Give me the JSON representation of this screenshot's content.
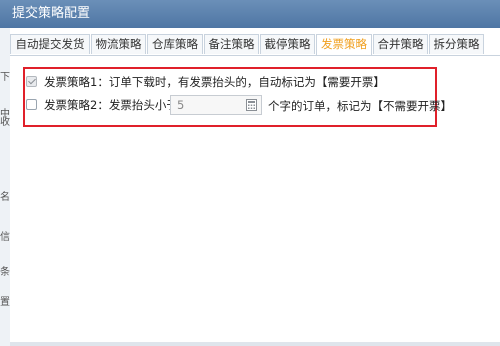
{
  "dialog": {
    "title": "提交策略配置"
  },
  "tabs": [
    {
      "label": "自动提交发货"
    },
    {
      "label": "物流策略"
    },
    {
      "label": "仓库策略"
    },
    {
      "label": "备注策略"
    },
    {
      "label": "截停策略"
    },
    {
      "label": "发票策略",
      "active": true
    },
    {
      "label": "合并策略"
    },
    {
      "label": "拆分策略"
    }
  ],
  "policies": {
    "policy1": {
      "checked": true,
      "text": "发票策略1：订单下载时，有发票抬头的，自动标记为【需要开票】"
    },
    "policy2": {
      "checked": false,
      "prefix": "发票策略2：发票抬头小于",
      "value": "5",
      "suffix": "个字的订单，标记为【不需要开票】"
    }
  },
  "left_strip": {
    "chars": [
      "下",
      "中",
      "收",
      "名",
      "信",
      "条",
      "置"
    ]
  },
  "colors": {
    "titlebar": "#5a7fae",
    "active_tab": "#f0a020",
    "highlight_border": "#e0202a"
  }
}
